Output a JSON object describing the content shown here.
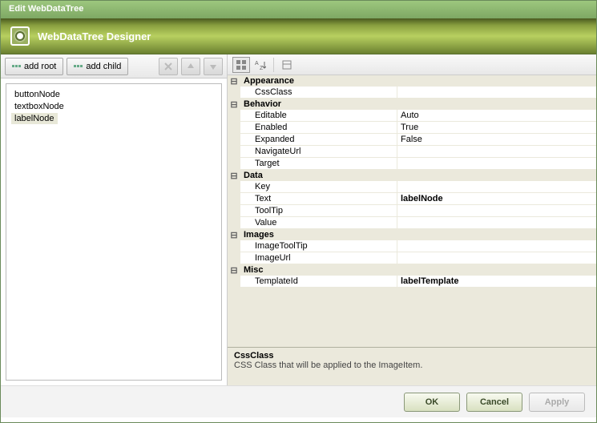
{
  "window": {
    "title": "Edit WebDataTree"
  },
  "banner": {
    "title": "WebDataTree Designer"
  },
  "toolbar": {
    "add_root": "add root",
    "add_child": "add child"
  },
  "tree": {
    "items": [
      "buttonNode",
      "textboxNode",
      "labelNode"
    ],
    "selected": 2
  },
  "properties": {
    "categories": [
      {
        "name": "Appearance",
        "rows": [
          {
            "name": "CssClass",
            "value": ""
          }
        ]
      },
      {
        "name": "Behavior",
        "rows": [
          {
            "name": "Editable",
            "value": "Auto"
          },
          {
            "name": "Enabled",
            "value": "True"
          },
          {
            "name": "Expanded",
            "value": "False"
          },
          {
            "name": "NavigateUrl",
            "value": ""
          },
          {
            "name": "Target",
            "value": ""
          }
        ]
      },
      {
        "name": "Data",
        "rows": [
          {
            "name": "Key",
            "value": ""
          },
          {
            "name": "Text",
            "value": "labelNode",
            "bold": true
          },
          {
            "name": "ToolTip",
            "value": ""
          },
          {
            "name": "Value",
            "value": ""
          }
        ]
      },
      {
        "name": "Images",
        "rows": [
          {
            "name": "ImageToolTip",
            "value": ""
          },
          {
            "name": "ImageUrl",
            "value": ""
          }
        ]
      },
      {
        "name": "Misc",
        "rows": [
          {
            "name": "TemplateId",
            "value": "labelTemplate",
            "bold": true
          }
        ]
      }
    ]
  },
  "description": {
    "title": "CssClass",
    "text": "CSS Class that will be applied to the ImageItem."
  },
  "buttons": {
    "ok": "OK",
    "cancel": "Cancel",
    "apply": "Apply"
  }
}
